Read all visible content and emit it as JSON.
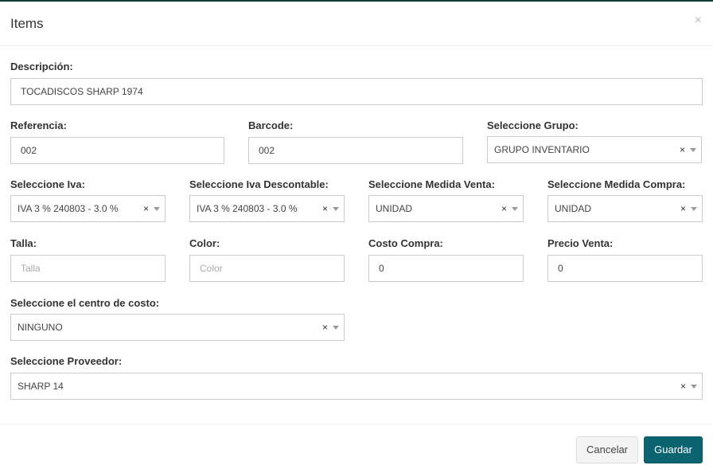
{
  "modal": {
    "title": "Items",
    "close": "×"
  },
  "fields": {
    "descripcion": {
      "label": "Descripción:",
      "value": "TOCADISCOS SHARP 1974"
    },
    "referencia": {
      "label": "Referencia:",
      "value": "002"
    },
    "barcode": {
      "label": "Barcode:",
      "value": "002"
    },
    "grupo": {
      "label": "Seleccione Grupo:",
      "value": "GRUPO INVENTARIO"
    },
    "iva": {
      "label": "Seleccione Iva:",
      "value": "IVA 3 % 240803 - 3.0 %"
    },
    "iva_descontable": {
      "label": "Seleccione Iva Descontable:",
      "value": "IVA 3 % 240803 - 3.0 %"
    },
    "medida_venta": {
      "label": "Seleccione Medida Venta:",
      "value": "UNIDAD"
    },
    "medida_compra": {
      "label": "Seleccione Medida Compra:",
      "value": "UNIDAD"
    },
    "talla": {
      "label": "Talla:",
      "placeholder": "Talla"
    },
    "color": {
      "label": "Color:",
      "placeholder": "Color"
    },
    "costo_compra": {
      "label": "Costo Compra:",
      "value": "0"
    },
    "precio_venta": {
      "label": "Precio Venta:",
      "value": "0"
    },
    "centro_costo": {
      "label": "Seleccione el centro de costo:",
      "value": "NINGUNO"
    },
    "proveedor": {
      "label": "Seleccione Proveedor:",
      "value": "SHARP 14"
    }
  },
  "clear_symbol": "×",
  "footer": {
    "cancel": "Cancelar",
    "save": "Guardar"
  }
}
